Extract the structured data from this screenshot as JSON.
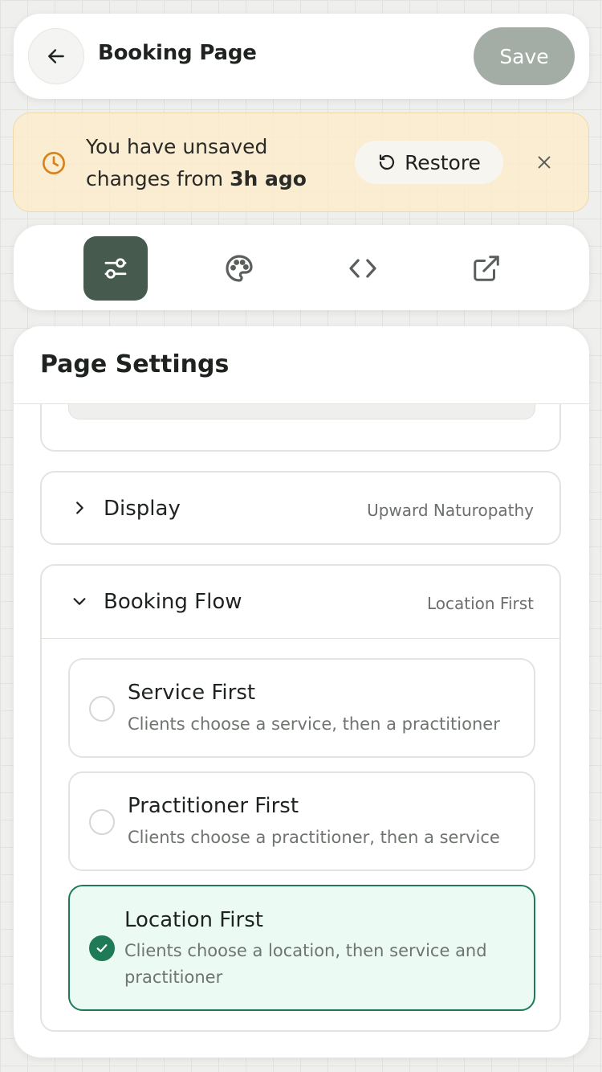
{
  "header": {
    "title": "Booking Page",
    "save_label": "Save"
  },
  "banner": {
    "message_line1": "You have unsaved",
    "message_prefix": "changes from ",
    "message_time": "3h ago",
    "restore_label": "Restore",
    "icon": "clock-icon",
    "accent": "#d7821a"
  },
  "tabs": [
    {
      "name": "settings",
      "icon": "sliders-icon",
      "active": true
    },
    {
      "name": "theme",
      "icon": "palette-icon",
      "active": false
    },
    {
      "name": "embed",
      "icon": "code-icon",
      "active": false
    },
    {
      "name": "open",
      "icon": "external-link-icon",
      "active": false
    }
  ],
  "panel": {
    "title": "Page Settings",
    "sections": {
      "display": {
        "title": "Display",
        "value": "Upward Naturopathy",
        "expanded": false
      },
      "booking_flow": {
        "title": "Booking Flow",
        "value": "Location First",
        "expanded": true,
        "options": [
          {
            "title": "Service First",
            "desc": "Clients choose a service, then a practitioner",
            "selected": false
          },
          {
            "title": "Practitioner First",
            "desc": "Clients choose a practitioner, then a service",
            "selected": false
          },
          {
            "title": "Location First",
            "desc": "Clients choose a location, then service and practitioner",
            "selected": true
          }
        ]
      }
    }
  },
  "colors": {
    "primary_dark": "#465b4d",
    "selected_green": "#1f7a57",
    "selected_bg": "#ebfaf2",
    "save_disabled": "#a3ada6",
    "banner_bg": "#fdecc8"
  }
}
